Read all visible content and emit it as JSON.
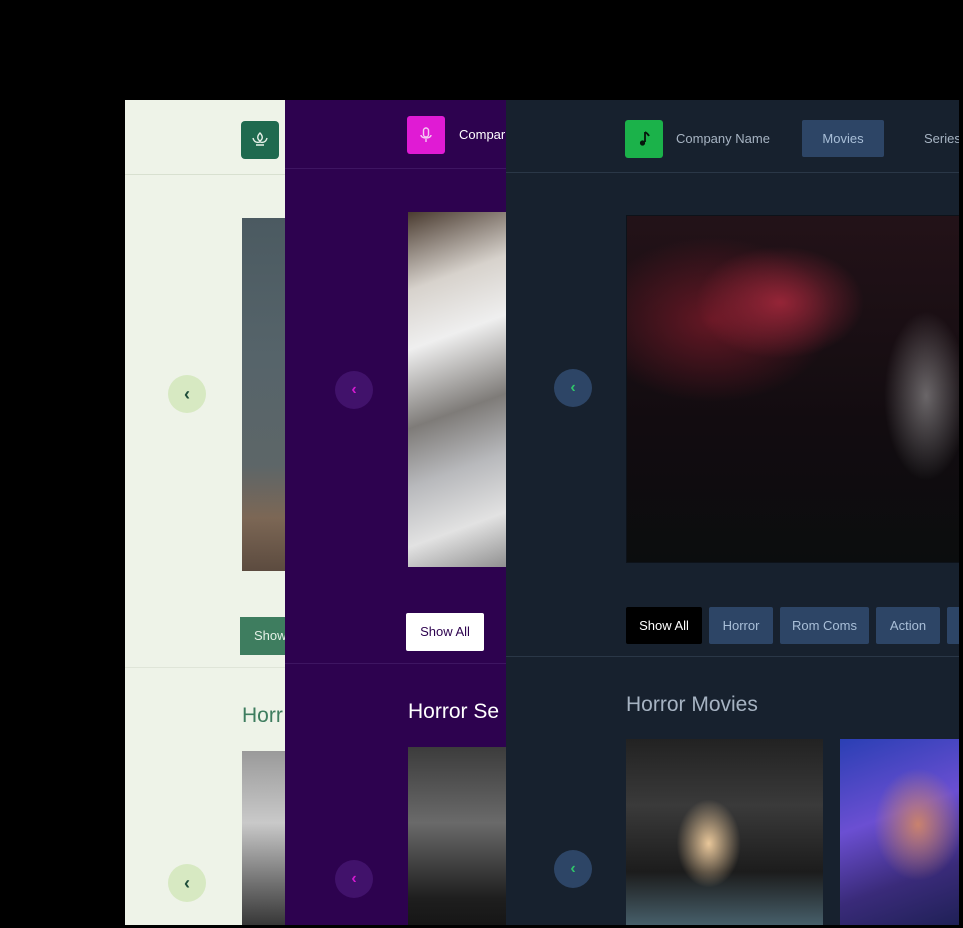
{
  "panel_light": {
    "show_label": "Show",
    "section_title": "Horr"
  },
  "panel_purple": {
    "company": "Compar",
    "show_label": "Show All",
    "section_title": "Horror Se"
  },
  "panel_dark": {
    "company": "Company Name",
    "nav": [
      "Movies",
      "Series"
    ],
    "chips": [
      "Show All",
      "Horror",
      "Rom Coms",
      "Action"
    ],
    "section_title": "Horror Movies"
  },
  "icons": {
    "arrow": "‹",
    "plant": "plant-icon",
    "mic": "microphone-icon",
    "music": "music-note-icon"
  },
  "colors": {
    "light_accent": "#3e7d5f",
    "purple_accent": "#e01bd4",
    "dark_accent": "#1bb24a"
  }
}
